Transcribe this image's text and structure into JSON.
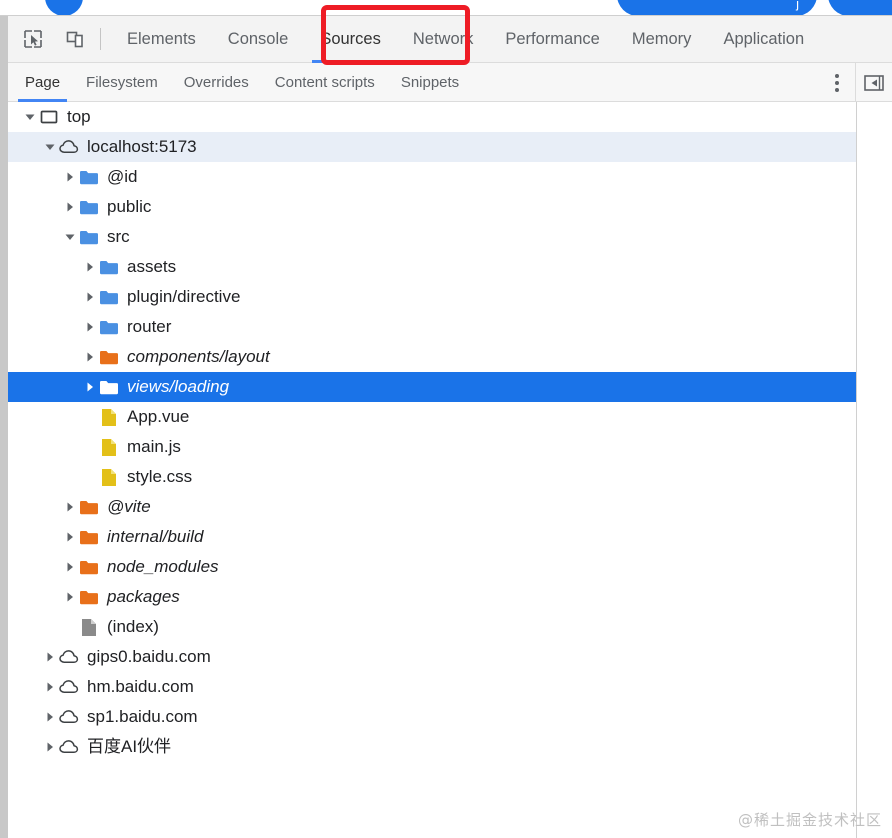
{
  "page_sliver": {
    "circle_color": "#1a73e8",
    "button_color": "#1a73e8",
    "button_caption": "j"
  },
  "toolbar": {
    "inspect_icon": "cursor-inspect-icon",
    "device_icon": "device-toolbar-icon",
    "tabs": [
      {
        "label": "Elements",
        "active": false
      },
      {
        "label": "Console",
        "active": false
      },
      {
        "label": "Sources",
        "active": true
      },
      {
        "label": "Network",
        "active": false
      },
      {
        "label": "Performance",
        "active": false
      },
      {
        "label": "Memory",
        "active": false
      },
      {
        "label": "Application",
        "active": false
      }
    ],
    "active_tab": "Sources",
    "accent_color": "#4285f4"
  },
  "subtoolbar": {
    "tabs": [
      {
        "label": "Page",
        "active": true
      },
      {
        "label": "Filesystem",
        "active": false
      },
      {
        "label": "Overrides",
        "active": false
      },
      {
        "label": "Content scripts",
        "active": false
      },
      {
        "label": "Snippets",
        "active": false
      }
    ],
    "active_tab": "Page",
    "more_options_icon": "kebab-menu-icon",
    "collapse_icon": "collapse-sidebar-icon"
  },
  "navigator_tree": {
    "selected": "views/loading",
    "highlighted": "localhost:5173",
    "selection_color": "#1a73e8",
    "highlight_color": "#e8eef7",
    "items": [
      {
        "label": "top",
        "icon": "frame-icon",
        "depth": 0,
        "twisty": "open",
        "state": "normal"
      },
      {
        "label": "localhost:5173",
        "icon": "cloud-icon",
        "depth": 1,
        "twisty": "open",
        "state": "highlighted"
      },
      {
        "label": "@id",
        "icon": "folder-blue-icon",
        "depth": 2,
        "twisty": "closed",
        "state": "normal"
      },
      {
        "label": "public",
        "icon": "folder-blue-icon",
        "depth": 2,
        "twisty": "closed",
        "state": "normal"
      },
      {
        "label": "src",
        "icon": "folder-blue-icon",
        "depth": 2,
        "twisty": "open",
        "state": "normal"
      },
      {
        "label": "assets",
        "icon": "folder-blue-icon",
        "depth": 3,
        "twisty": "closed",
        "state": "normal"
      },
      {
        "label": "plugin/directive",
        "icon": "folder-blue-icon",
        "depth": 3,
        "twisty": "closed",
        "state": "normal"
      },
      {
        "label": "router",
        "icon": "folder-blue-icon",
        "depth": 3,
        "twisty": "closed",
        "state": "normal"
      },
      {
        "label": "components/layout",
        "icon": "folder-orange-icon",
        "depth": 3,
        "twisty": "closed",
        "state": "italic"
      },
      {
        "label": "views/loading",
        "icon": "folder-white-icon",
        "depth": 3,
        "twisty": "closed",
        "state": "selected-italic"
      },
      {
        "label": "App.vue",
        "icon": "file-yellow-icon",
        "depth": 3,
        "twisty": "none",
        "state": "normal"
      },
      {
        "label": "main.js",
        "icon": "file-yellow-icon",
        "depth": 3,
        "twisty": "none",
        "state": "normal"
      },
      {
        "label": "style.css",
        "icon": "file-yellow-icon",
        "depth": 3,
        "twisty": "none",
        "state": "normal"
      },
      {
        "label": "@vite",
        "icon": "folder-orange-icon",
        "depth": 2,
        "twisty": "closed",
        "state": "italic"
      },
      {
        "label": "internal/build",
        "icon": "folder-orange-icon",
        "depth": 2,
        "twisty": "closed",
        "state": "italic"
      },
      {
        "label": "node_modules",
        "icon": "folder-orange-icon",
        "depth": 2,
        "twisty": "closed",
        "state": "italic"
      },
      {
        "label": "packages",
        "icon": "folder-orange-icon",
        "depth": 2,
        "twisty": "closed",
        "state": "italic"
      },
      {
        "label": "(index)",
        "icon": "file-gray-icon",
        "depth": 2,
        "twisty": "none",
        "state": "normal"
      },
      {
        "label": "gips0.baidu.com",
        "icon": "cloud-icon",
        "depth": 1,
        "twisty": "closed",
        "state": "normal"
      },
      {
        "label": "hm.baidu.com",
        "icon": "cloud-icon",
        "depth": 1,
        "twisty": "closed",
        "state": "normal"
      },
      {
        "label": "sp1.baidu.com",
        "icon": "cloud-icon",
        "depth": 1,
        "twisty": "closed",
        "state": "normal"
      },
      {
        "label": "百度AI伙伴",
        "icon": "cloud-icon",
        "depth": 1,
        "twisty": "closed",
        "state": "normal"
      }
    ]
  },
  "annotation": {
    "shape": "rectangle",
    "color": "#ee1c25",
    "targets": "Sources"
  },
  "watermark": {
    "text": "@稀土掘金技术社区"
  }
}
